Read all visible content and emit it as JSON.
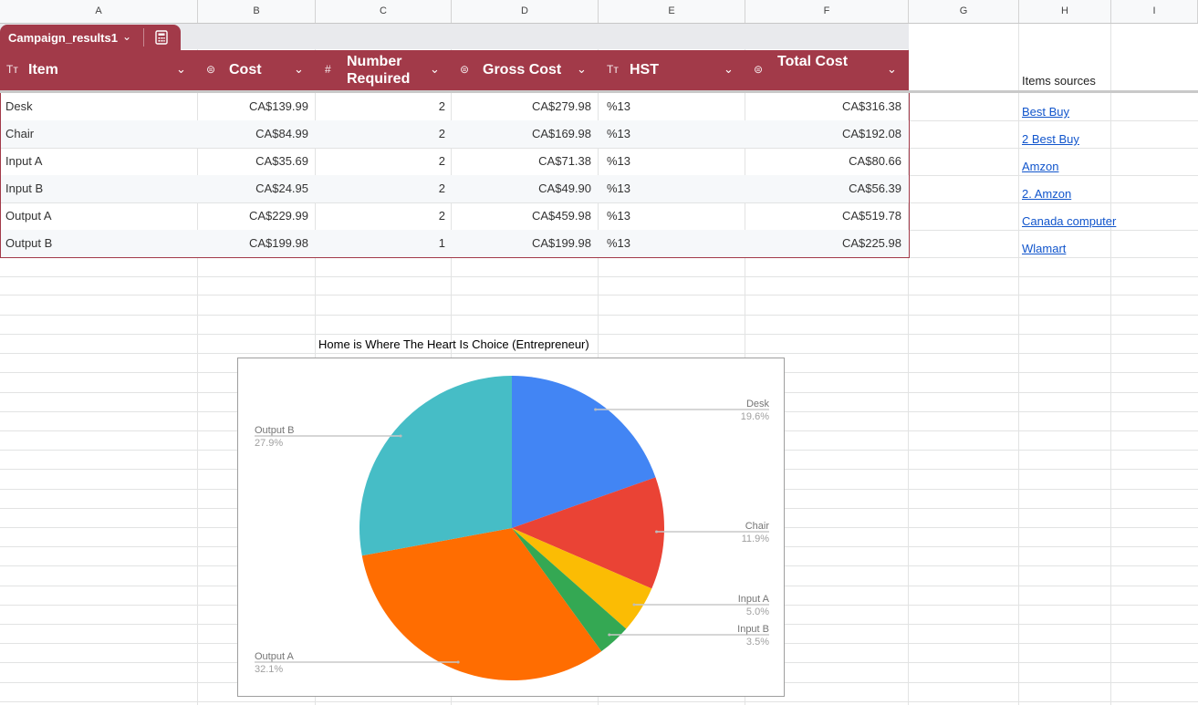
{
  "columns": [
    "A",
    "B",
    "C",
    "D",
    "E",
    "F",
    "G",
    "H",
    "I"
  ],
  "table": {
    "name": "Campaign_results1",
    "headers": {
      "item": "Item",
      "cost": "Cost",
      "number": "Number\nRequired",
      "gross": "Gross Cost",
      "hst": "HST",
      "total": "Total Cost"
    },
    "header_icons": {
      "item": "text-type-icon",
      "cost": "currency-icon",
      "number": "number-icon",
      "gross": "currency-icon",
      "hst": "text-type-icon",
      "total": "currency-icon"
    },
    "rows": [
      {
        "item": "Desk",
        "cost": "CA$139.99",
        "number": "2",
        "gross": "CA$279.98",
        "hst": "%13",
        "total": "CA$316.38"
      },
      {
        "item": "Chair",
        "cost": "CA$84.99",
        "number": "2",
        "gross": "CA$169.98",
        "hst": "%13",
        "total": "CA$192.08"
      },
      {
        "item": "Input A",
        "cost": "CA$35.69",
        "number": "2",
        "gross": "CA$71.38",
        "hst": "%13",
        "total": "CA$80.66"
      },
      {
        "item": "Input B",
        "cost": "CA$24.95",
        "number": "2",
        "gross": "CA$49.90",
        "hst": "%13",
        "total": "CA$56.39"
      },
      {
        "item": "Output A",
        "cost": "CA$229.99",
        "number": "2",
        "gross": "CA$459.98",
        "hst": "%13",
        "total": "CA$519.78"
      },
      {
        "item": "Output B",
        "cost": "CA$199.98",
        "number": "1",
        "gross": "CA$199.98",
        "hst": "%13",
        "total": "CA$225.98"
      }
    ]
  },
  "sources": {
    "title": "Items sources",
    "links": [
      "Best Buy",
      "2 Best Buy",
      "Amzon",
      "2. Amzon",
      "Canada computer",
      "Wlamart"
    ]
  },
  "colors": {
    "table_header": "#a23a49",
    "link": "#1155cc"
  },
  "chart_data": {
    "type": "pie",
    "title": "Home is Where The Heart Is Choice (Entrepreneur)",
    "slices": [
      {
        "label": "Desk",
        "value": 19.6,
        "pct": "19.6%",
        "color": "#4285f4"
      },
      {
        "label": "Chair",
        "value": 11.9,
        "pct": "11.9%",
        "color": "#ea4335"
      },
      {
        "label": "Input A",
        "value": 5.0,
        "pct": "5.0%",
        "color": "#fbbc04"
      },
      {
        "label": "Input B",
        "value": 3.5,
        "pct": "3.5%",
        "color": "#34a853"
      },
      {
        "label": "Output A",
        "value": 32.1,
        "pct": "32.1%",
        "color": "#ff6d01"
      },
      {
        "label": "Output B",
        "value": 27.9,
        "pct": "27.9%",
        "color": "#46bdc6"
      }
    ],
    "legend": "labels-with-leader-lines"
  }
}
